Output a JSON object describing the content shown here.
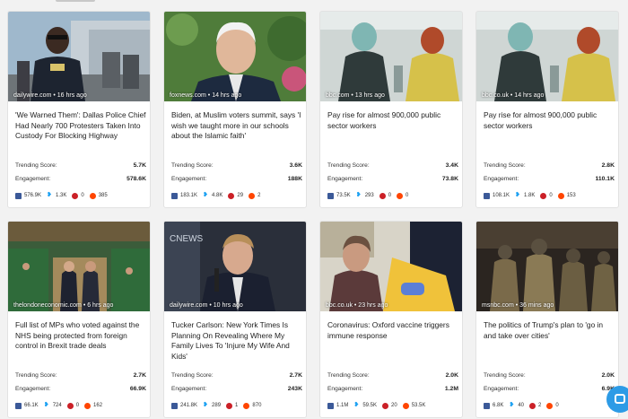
{
  "cards": [
    {
      "source": "dailywire.com • 16 hrs ago",
      "title": "'We Warned Them': Dallas Police Chief Had Nearly 700 Protesters Taken Into Custody For Blocking Highway",
      "trending_label": "Trending Score:",
      "trending": "5.7K",
      "engagement_label": "Engagement:",
      "engagement": "578.6K",
      "fb": "576.9K",
      "tw": "1.3K",
      "pin": "0",
      "rd": "385"
    },
    {
      "source": "foxnews.com • 14 hrs ago",
      "title": "Biden, at Muslim voters summit, says 'I wish we taught more in our schools about the Islamic faith'",
      "trending_label": "Trending Score:",
      "trending": "3.6K",
      "engagement_label": "Engagement:",
      "engagement": "188K",
      "fb": "183.1K",
      "tw": "4.8K",
      "pin": "29",
      "rd": "2"
    },
    {
      "source": "bbc.com • 13 hrs ago",
      "title": "Pay rise for almost 900,000 public sector workers",
      "trending_label": "Trending Score:",
      "trending": "3.4K",
      "engagement_label": "Engagement:",
      "engagement": "73.8K",
      "fb": "73.5K",
      "tw": "293",
      "pin": "0",
      "rd": "0"
    },
    {
      "source": "bbc.co.uk • 14 hrs ago",
      "title": "Pay rise for almost 900,000 public sector workers",
      "trending_label": "Trending Score:",
      "trending": "2.8K",
      "engagement_label": "Engagement:",
      "engagement": "110.1K",
      "fb": "108.1K",
      "tw": "1.8K",
      "pin": "0",
      "rd": "153"
    },
    {
      "source": "thelondoneconomic.com • 6 hrs ago",
      "title": "Full list of MPs who voted against the NHS being protected from foreign control in Brexit trade deals",
      "trending_label": "Trending Score:",
      "trending": "2.7K",
      "engagement_label": "Engagement:",
      "engagement": "66.9K",
      "fb": "66.1K",
      "tw": "724",
      "pin": "0",
      "rd": "162"
    },
    {
      "source": "dailywire.com • 10 hrs ago",
      "title": "Tucker Carlson: New York Times Is Planning On Revealing Where My Family Lives To 'Injure My Wife And Kids'",
      "trending_label": "Trending Score:",
      "trending": "2.7K",
      "engagement_label": "Engagement:",
      "engagement": "243K",
      "fb": "241.8K",
      "tw": "289",
      "pin": "1",
      "rd": "870"
    },
    {
      "source": "bbc.co.uk • 23 hrs ago",
      "title": "Coronavirus: Oxford vaccine triggers immune response",
      "trending_label": "Trending Score:",
      "trending": "2.0K",
      "engagement_label": "Engagement:",
      "engagement": "1.2M",
      "fb": "1.1M",
      "tw": "59.5K",
      "pin": "20",
      "rd": "53.5K"
    },
    {
      "source": "msnbc.com • 36 mins ago",
      "title": "The politics of Trump's plan to 'go in and take over cities'",
      "trending_label": "Trending Score:",
      "trending": "2.0K",
      "engagement_label": "Engagement:",
      "engagement": "6.9K",
      "fb": "6.8K",
      "tw": "40",
      "pin": "2",
      "rd": "0"
    }
  ],
  "colors": {
    "facebook": "#3b5998",
    "twitter": "#1da1f2",
    "pinterest": "#cb2027",
    "reddit": "#ff4500",
    "chat": "#2d9be6"
  },
  "icons": {
    "facebook": "facebook-icon",
    "twitter": "twitter-icon",
    "pinterest": "pinterest-icon",
    "reddit": "reddit-icon",
    "chat": "chat-icon"
  }
}
